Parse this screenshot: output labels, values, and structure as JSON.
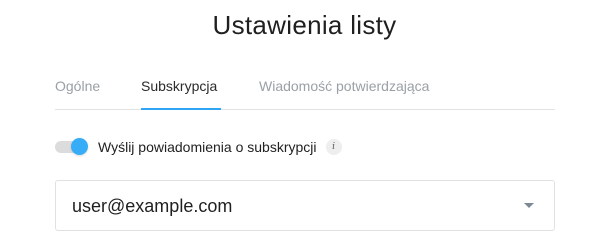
{
  "title": "Ustawienia listy",
  "tabs": [
    {
      "label": "Ogólne",
      "active": false
    },
    {
      "label": "Subskrypcja",
      "active": true
    },
    {
      "label": "Wiadomość potwierdzająca",
      "active": false
    }
  ],
  "subscription_notification": {
    "label": "Wyślij powiadomienia o subskrypcji",
    "enabled": true,
    "info_icon": "info-icon"
  },
  "email_select": {
    "value": "user@example.com"
  },
  "colors": {
    "accent": "#2ea5f2",
    "toggle_on": "#36adf6"
  }
}
